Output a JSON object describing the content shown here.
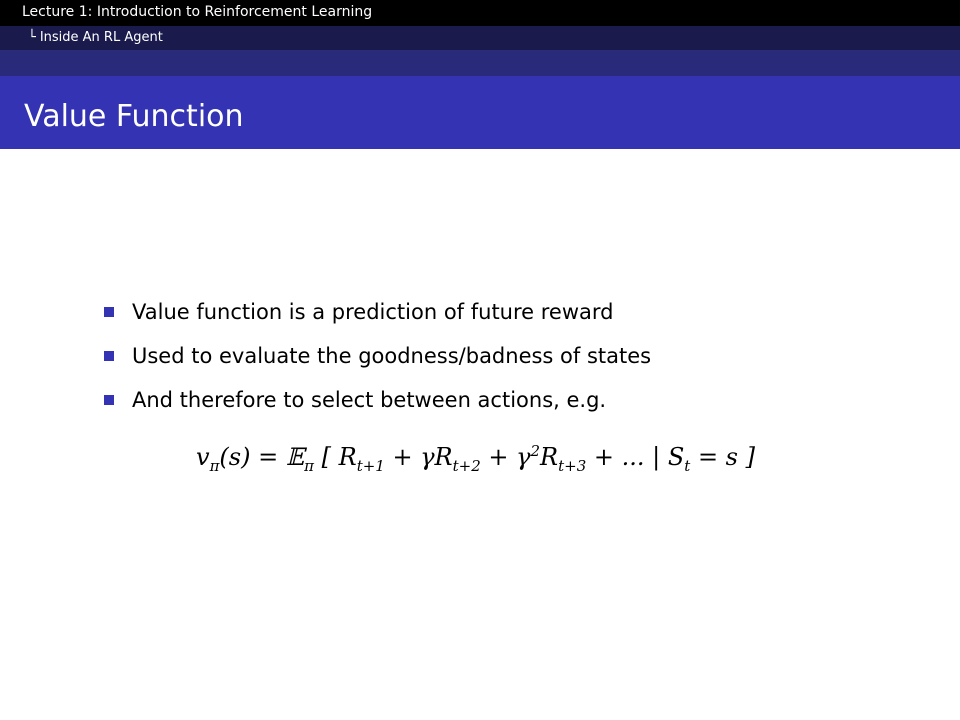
{
  "header": {
    "lecture": "Lecture 1: Introduction to Reinforcement Learning",
    "section": "Inside An RL Agent",
    "tree_glyph": "└"
  },
  "slide": {
    "title": "Value Function",
    "bullets": [
      "Value function is a prediction of future reward",
      "Used to evaluate the goodness/badness of states",
      "And therefore to select between actions, e.g."
    ]
  },
  "colors": {
    "topbar": "#000000",
    "subbar": "#1a1a4d",
    "band": "#2a2a7a",
    "title_bar": "#3333b3",
    "bullet": "#3333b3"
  },
  "icons": {
    "bullet": "blue-square-bullet"
  }
}
